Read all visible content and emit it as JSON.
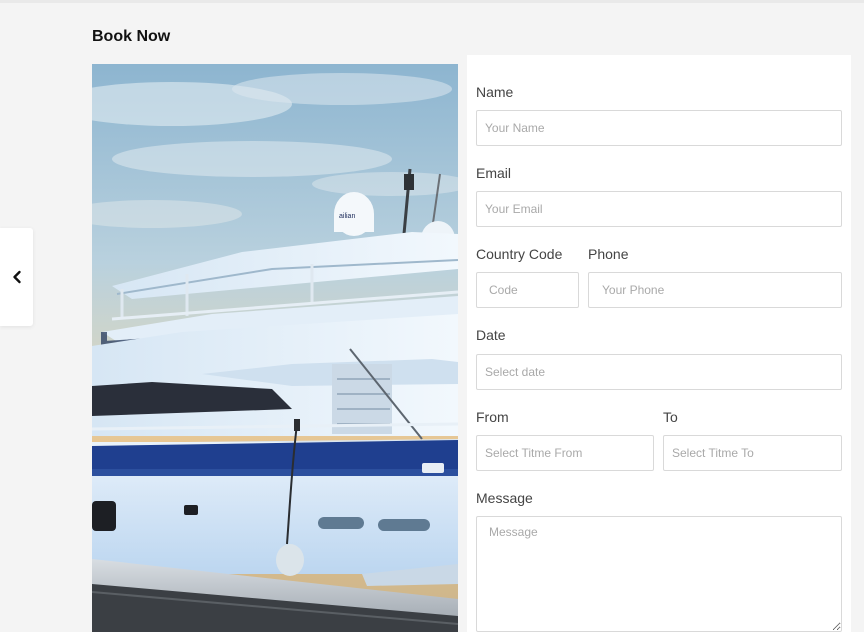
{
  "page": {
    "title": "Book Now"
  },
  "photo": {
    "alt": "yacht",
    "hull_text": "ailian"
  },
  "form": {
    "name": {
      "label": "Name",
      "placeholder": "Your Name",
      "value": ""
    },
    "email": {
      "label": "Email",
      "placeholder": "Your Email",
      "value": ""
    },
    "country_code": {
      "label": "Country Code",
      "placeholder": "Code",
      "value": ""
    },
    "phone": {
      "label": "Phone",
      "placeholder": "Your Phone",
      "value": ""
    },
    "date": {
      "label": "Date",
      "placeholder": "Select date",
      "value": ""
    },
    "time_from": {
      "label": "From",
      "placeholder": "Select Titme From",
      "value": ""
    },
    "time_to": {
      "label": "To",
      "placeholder": "Select Titme To",
      "value": ""
    },
    "message": {
      "label": "Message",
      "placeholder": "Message",
      "value": ""
    }
  },
  "icons": {
    "back": "chevron-left-icon"
  },
  "colors": {
    "background": "#f4f4f4",
    "panel": "#ffffff",
    "border": "#d9d9d9",
    "label": "#444444",
    "placeholder": "#a9a9a9",
    "hull_stripe": "#1f3f8f"
  }
}
